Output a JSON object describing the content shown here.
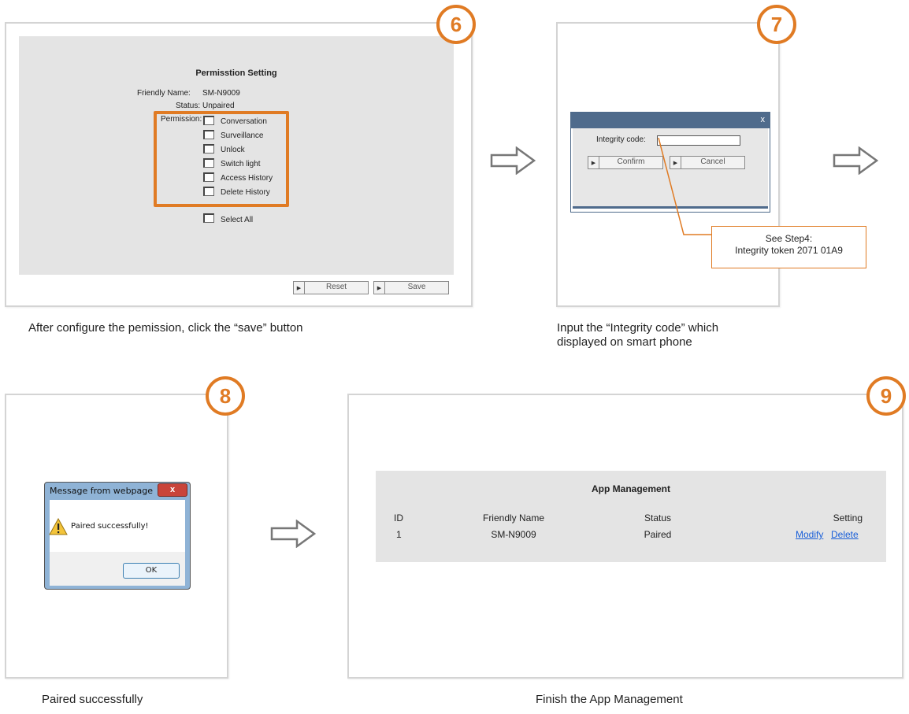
{
  "step6": {
    "badge": "6",
    "title": "Permisstion Setting",
    "friendly_name_label": "Friendly Name:",
    "friendly_name_value": "SM-N9009",
    "status_label": "Status:",
    "status_value": "Unpaired",
    "permission_label": "Permission:",
    "permissions": [
      "Conversation",
      "Surveillance",
      "Unlock",
      "Switch light",
      "Access History",
      "Delete History"
    ],
    "select_all": "Select All",
    "reset_label": "Reset",
    "save_label": "Save",
    "caption": "After configure the pemission, click the “save” button"
  },
  "step7": {
    "badge": "7",
    "close_label": "x",
    "integrity_label": "Integrity code:",
    "integrity_value": "",
    "confirm_label": "Confirm",
    "cancel_label": "Cancel",
    "callout_line1": "See Step4:",
    "callout_line2": "Integrity token 2071 01A9",
    "caption_line1": "Input the “Integrity code” which",
    "caption_line2": "displayed on smart phone"
  },
  "step8": {
    "badge": "8",
    "window_title": "Message from webpage",
    "close_label": "x",
    "message": "Paired successfully!",
    "ok_label": "OK",
    "caption": "Paired successfully"
  },
  "step9": {
    "badge": "9",
    "title": "App Management",
    "columns": [
      "ID",
      "Friendly Name",
      "Status",
      "Setting"
    ],
    "row": {
      "id": "1",
      "name": "SM-N9009",
      "status": "Paired",
      "modify": "Modify",
      "delete": "Delete"
    },
    "caption": "Finish the App Management"
  },
  "colors": {
    "accent": "#e07b24",
    "panel": "#e4e4e4",
    "link": "#1a5fd8",
    "dialog_bar": "#4f6b8c"
  },
  "icons": [
    "arrow-right-icon",
    "warning-icon",
    "play-icon"
  ]
}
